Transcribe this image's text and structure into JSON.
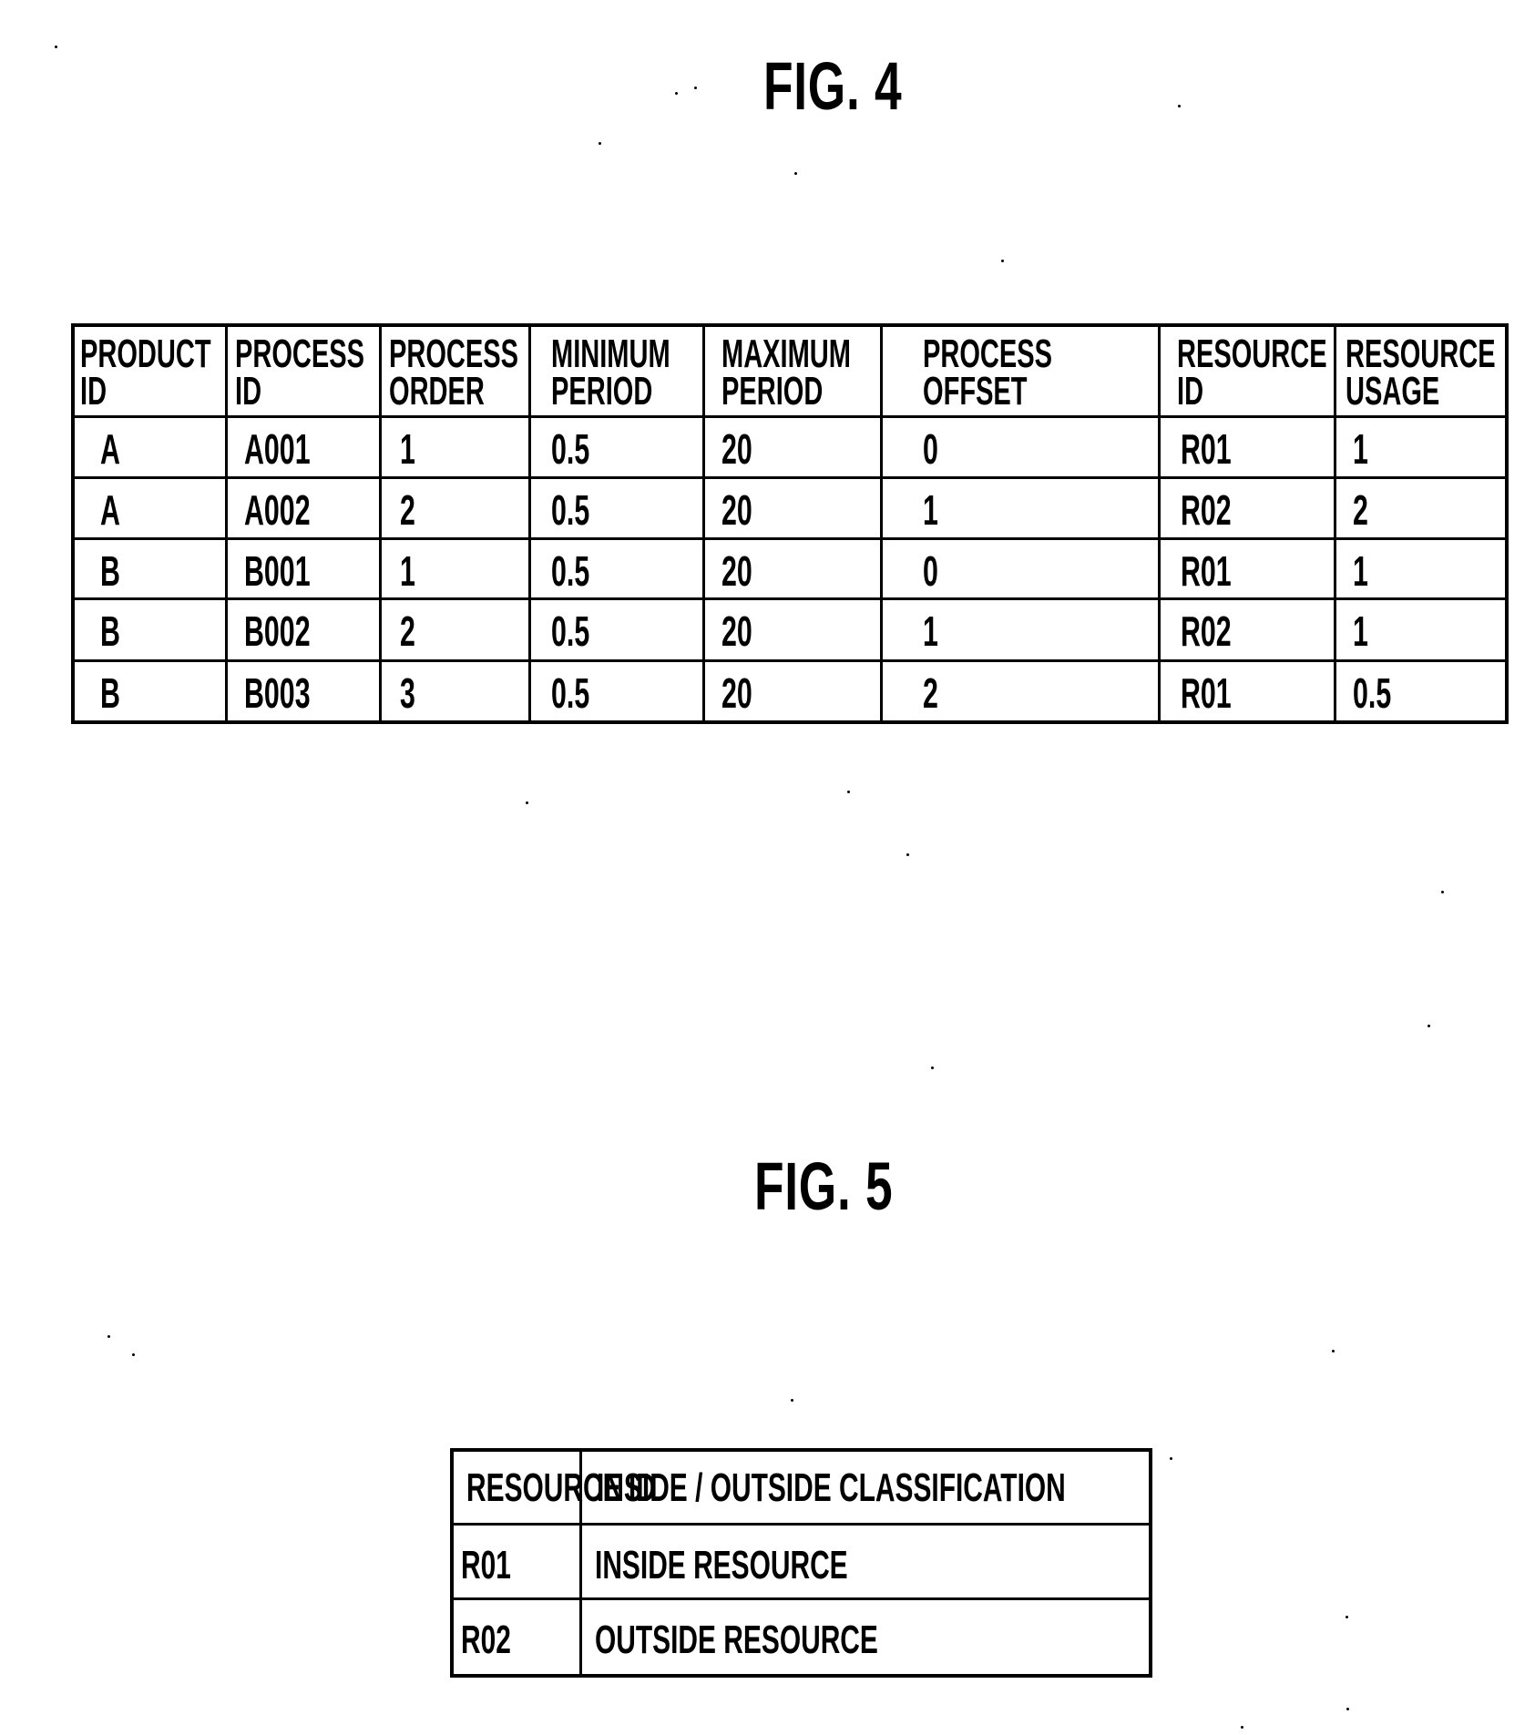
{
  "figures": [
    {
      "title": "FIG. 4",
      "table": {
        "headers": [
          [
            "PRODUCT",
            "ID"
          ],
          [
            "PROCESS",
            "ID"
          ],
          [
            "PROCESS",
            "ORDER"
          ],
          [
            "MINIMUM",
            "PERIOD"
          ],
          [
            "MAXIMUM",
            "PERIOD"
          ],
          [
            "PROCESS",
            "OFFSET"
          ],
          [
            "RESOURCE",
            "ID"
          ],
          [
            "RESOURCE",
            "USAGE"
          ]
        ],
        "rows": [
          [
            "A",
            "A001",
            "1",
            "0.5",
            "20",
            "0",
            "R01",
            "1"
          ],
          [
            "A",
            "A002",
            "2",
            "0.5",
            "20",
            "1",
            "R02",
            "2"
          ],
          [
            "B",
            "B001",
            "1",
            "0.5",
            "20",
            "0",
            "R01",
            "1"
          ],
          [
            "B",
            "B002",
            "2",
            "0.5",
            "20",
            "1",
            "R02",
            "1"
          ],
          [
            "B",
            "B003",
            "3",
            "0.5",
            "20",
            "2",
            "R01",
            "0.5"
          ]
        ]
      }
    },
    {
      "title": "FIG. 5",
      "table": {
        "headers": [
          "RESOURCE ID",
          "INSIDE / OUTSIDE CLASSIFICATION"
        ],
        "rows": [
          [
            "R01",
            "INSIDE RESOURCE"
          ],
          [
            "R02",
            "OUTSIDE RESOURCE"
          ]
        ]
      }
    }
  ]
}
